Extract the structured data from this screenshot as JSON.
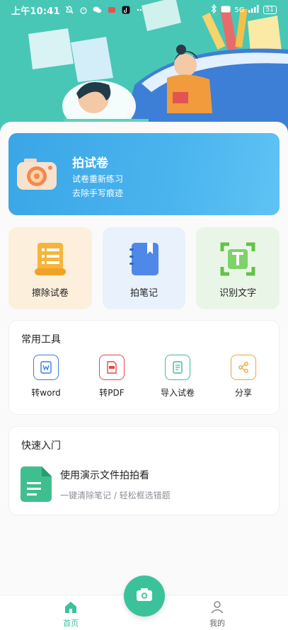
{
  "status_bar": {
    "time": "上午10:41",
    "left_icons": [
      "mute-bell-icon",
      "alarm-icon",
      "wechat-icon",
      "app-icon",
      "tiktok-icon",
      "more-dots-icon"
    ],
    "right_icons": [
      "bluetooth-icon",
      "hd-icon",
      "signal-icon"
    ],
    "network": "5G",
    "battery": "51"
  },
  "banner": {
    "title": "拍试卷",
    "line1": "试卷重新练习",
    "line2": "去除手写痕迹"
  },
  "tiles": [
    {
      "label": "擦除试卷",
      "icon": "scroll-icon",
      "bg": "#fcefdc"
    },
    {
      "label": "拍笔记",
      "icon": "notebook-icon",
      "bg": "#e9f1fd"
    },
    {
      "label": "识别文字",
      "icon": "text-scan-icon",
      "bg": "#e9f6e7"
    }
  ],
  "tools": {
    "title": "常用工具",
    "items": [
      {
        "label": "转word",
        "icon": "word-icon",
        "color": "#3b7be0"
      },
      {
        "label": "转PDF",
        "icon": "pdf-icon",
        "color": "#e0494a"
      },
      {
        "label": "导入试卷",
        "icon": "import-paper-icon",
        "color": "#3cbf97"
      },
      {
        "label": "分享",
        "icon": "share-icon",
        "color": "#f0a23a"
      }
    ]
  },
  "quick": {
    "title": "快速入门",
    "item_title": "使用演示文件拍拍看",
    "item_sub": "一键清除笔记 / 轻松框选错题"
  },
  "nav": {
    "home": "首页",
    "mine": "我的",
    "active_color": "#3cc29b"
  }
}
